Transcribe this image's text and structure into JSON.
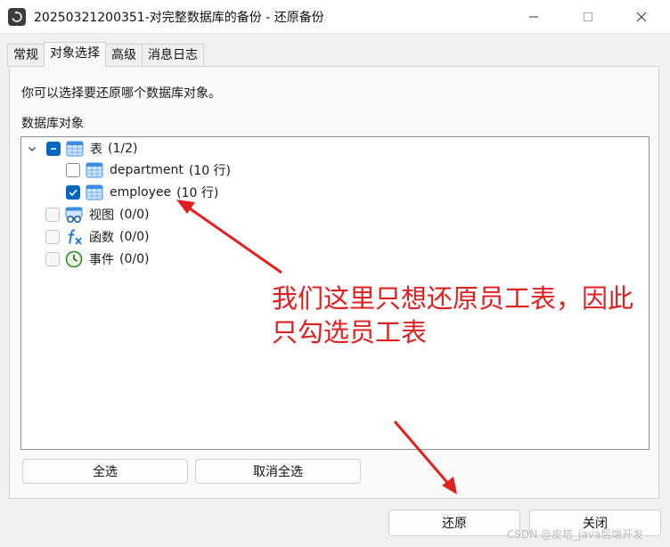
{
  "window": {
    "title": "20250321200351-对完整数据库的备份 - 还原备份"
  },
  "tabs": [
    {
      "label": "常规"
    },
    {
      "label": "对象选择"
    },
    {
      "label": "高级"
    },
    {
      "label": "消息日志"
    }
  ],
  "panel": {
    "description": "你可以选择要还原哪个数据库对象。",
    "group_label": "数据库对象"
  },
  "tree": {
    "tables": {
      "label": "表",
      "count": "(1/2)",
      "state": "partial",
      "icon": "table-icon"
    },
    "children": [
      {
        "label": "department",
        "count": "(10 行)",
        "checked": false,
        "icon": "table-icon"
      },
      {
        "label": "employee",
        "count": "(10 行)",
        "checked": true,
        "icon": "table-icon"
      }
    ],
    "views": {
      "label": "视图",
      "count": "(0/0)",
      "icon": "view-icon"
    },
    "functions": {
      "label": "函数",
      "count": "(0/0)",
      "icon": "function-icon"
    },
    "events": {
      "label": "事件",
      "count": "(0/0)",
      "icon": "event-clock-icon"
    }
  },
  "buttons": {
    "select_all": "全选",
    "deselect_all": "取消全选",
    "restore": "还原",
    "close": "关闭"
  },
  "annotation": {
    "text": "我们这里只想还原员工表，因此只勾选员工表",
    "color": "#e02020"
  },
  "watermark": "CSDN @皮塔_java后端开发",
  "colors": {
    "accent": "#0067c0"
  }
}
